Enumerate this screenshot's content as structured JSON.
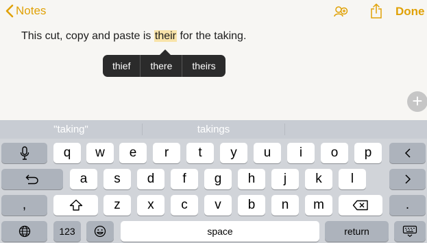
{
  "header": {
    "back_label": "Notes",
    "done_label": "Done"
  },
  "note": {
    "text_before": "This cut, copy and paste is ",
    "selected_word": "their",
    "text_after": " for the taking."
  },
  "suggestion_popup": {
    "items": [
      "thief",
      "there",
      "theirs"
    ]
  },
  "predictive_bar": {
    "items": [
      "\"taking\"",
      "takings",
      ""
    ]
  },
  "keyboard": {
    "row1": [
      "q",
      "w",
      "e",
      "r",
      "t",
      "y",
      "u",
      "i",
      "o",
      "p"
    ],
    "row2": [
      "a",
      "s",
      "d",
      "f",
      "g",
      "h",
      "j",
      "k",
      "l"
    ],
    "row3": [
      "z",
      "x",
      "c",
      "v",
      "b",
      "n",
      "m"
    ],
    "row3_left": ",",
    "row3_right": ".",
    "number_key": "123",
    "space_label": "space",
    "return_label": "return"
  },
  "colors": {
    "accent": "#e0a106",
    "highlight": "#f8e3a9",
    "popup": "#2b2b2b",
    "keyboard_bg": "#d1d4d9",
    "dark_key": "#adb3bc"
  },
  "icons": [
    "chevron-left-icon",
    "add-people-icon",
    "share-icon",
    "plus-icon",
    "microphone-icon",
    "chevron-left-icon",
    "undo-icon",
    "chevron-right-icon",
    "shift-icon",
    "delete-icon",
    "globe-icon",
    "emoji-icon",
    "keyboard-dismiss-icon"
  ]
}
